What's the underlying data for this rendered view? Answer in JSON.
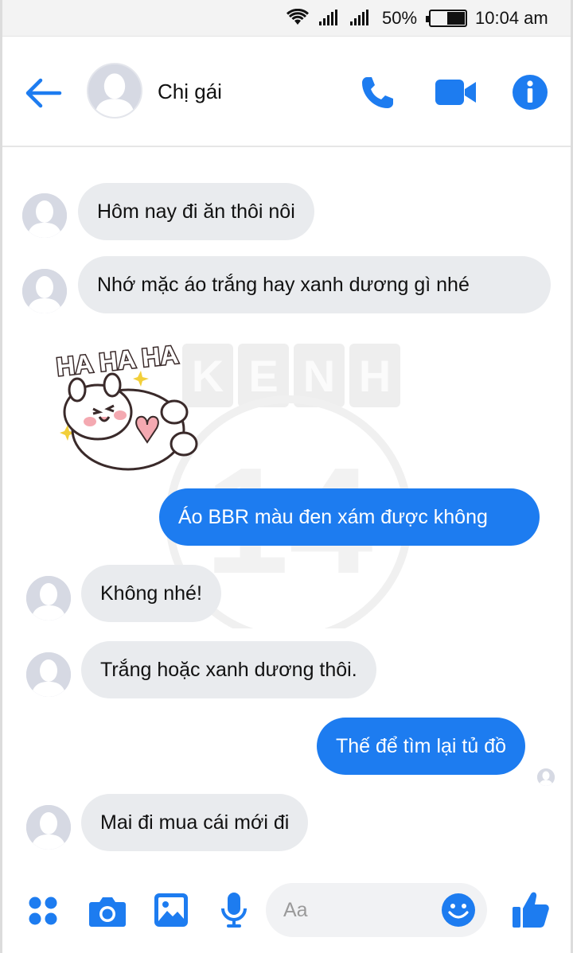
{
  "status_bar": {
    "battery_percent": "50%",
    "time": "10:04 am",
    "icons": [
      "wifi-icon",
      "signal-icon",
      "signal-icon",
      "battery-icon"
    ],
    "battery_level": 0.5
  },
  "header": {
    "contact_name": "Chị gái",
    "icons": [
      "back-arrow-icon",
      "avatar-placeholder-icon",
      "phone-icon",
      "video-camera-icon",
      "info-icon"
    ]
  },
  "colors": {
    "accent": "#1d7cf0",
    "incoming_bubble": "#e9ebee",
    "outgoing_text": "#ffffff"
  },
  "watermark": {
    "text": "KENH",
    "number": "14"
  },
  "sticker": {
    "text": "HA HA HA"
  },
  "messages": [
    {
      "direction": "incoming",
      "text": "Hôm nay đi ăn thôi nôi"
    },
    {
      "direction": "incoming",
      "text": "Nhớ mặc áo trắng hay xanh dương gì nhé"
    },
    {
      "direction": "incoming",
      "type": "sticker",
      "text": "HA HA HA"
    },
    {
      "direction": "outgoing",
      "text": "Áo BBR màu đen xám được không"
    },
    {
      "direction": "incoming",
      "text": "Không nhé!"
    },
    {
      "direction": "incoming",
      "text": "Trắng hoặc xanh dương thôi."
    },
    {
      "direction": "outgoing",
      "text": "Thế để tìm lại tủ đồ"
    },
    {
      "direction": "incoming",
      "text": "Mai đi mua cái mới đi"
    }
  ],
  "composer": {
    "placeholder": "Aa",
    "icons": [
      "apps-grid-icon",
      "camera-icon",
      "image-icon",
      "microphone-icon",
      "smiley-icon",
      "thumbs-up-icon"
    ]
  }
}
